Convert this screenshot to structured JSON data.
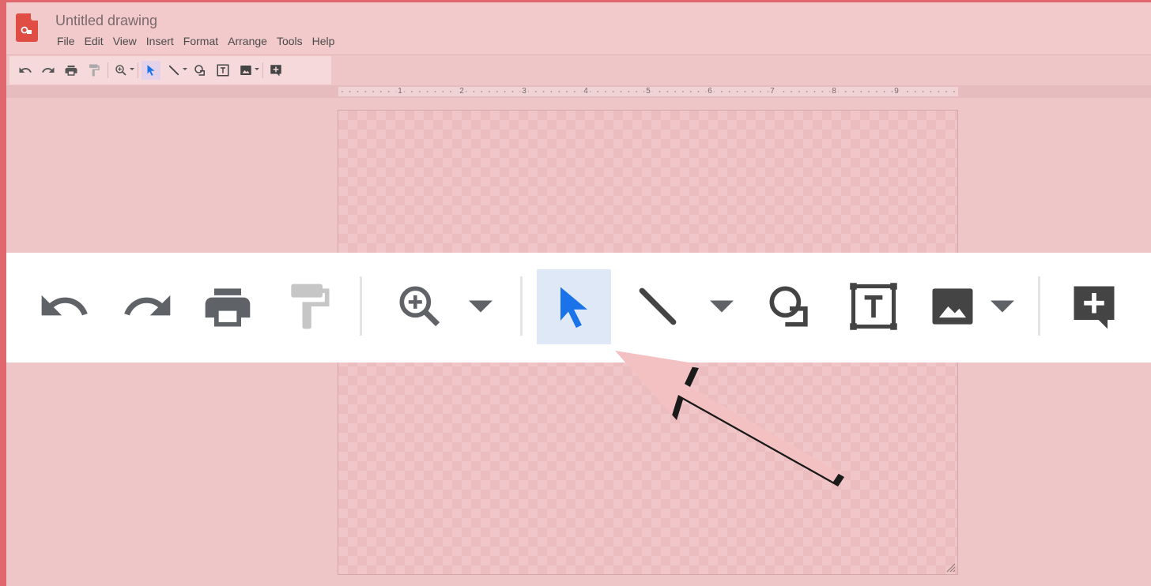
{
  "app": {
    "title": "Untitled drawing",
    "logo_icon": "google-drawings-logo-icon"
  },
  "menu": [
    "File",
    "Edit",
    "View",
    "Insert",
    "Format",
    "Arrange",
    "Tools",
    "Help"
  ],
  "toolbar": {
    "tools": [
      {
        "name": "undo-icon"
      },
      {
        "name": "redo-icon"
      },
      {
        "name": "print-icon"
      },
      {
        "name": "paint-format-icon"
      },
      {
        "name": "zoom-icon"
      },
      {
        "name": "select-icon",
        "active": true
      },
      {
        "name": "line-icon"
      },
      {
        "name": "shape-icon"
      },
      {
        "name": "text-box-icon"
      },
      {
        "name": "image-icon"
      },
      {
        "name": "add-comment-icon"
      }
    ]
  },
  "ruler": {
    "labels": [
      "1",
      "2",
      "3",
      "4",
      "5",
      "6",
      "7",
      "8",
      "9"
    ]
  },
  "colors": {
    "frame": "#e0676d",
    "accent_select": "#1a73e8",
    "background": "#efc6c8",
    "arrow": "#f4c1c3"
  }
}
